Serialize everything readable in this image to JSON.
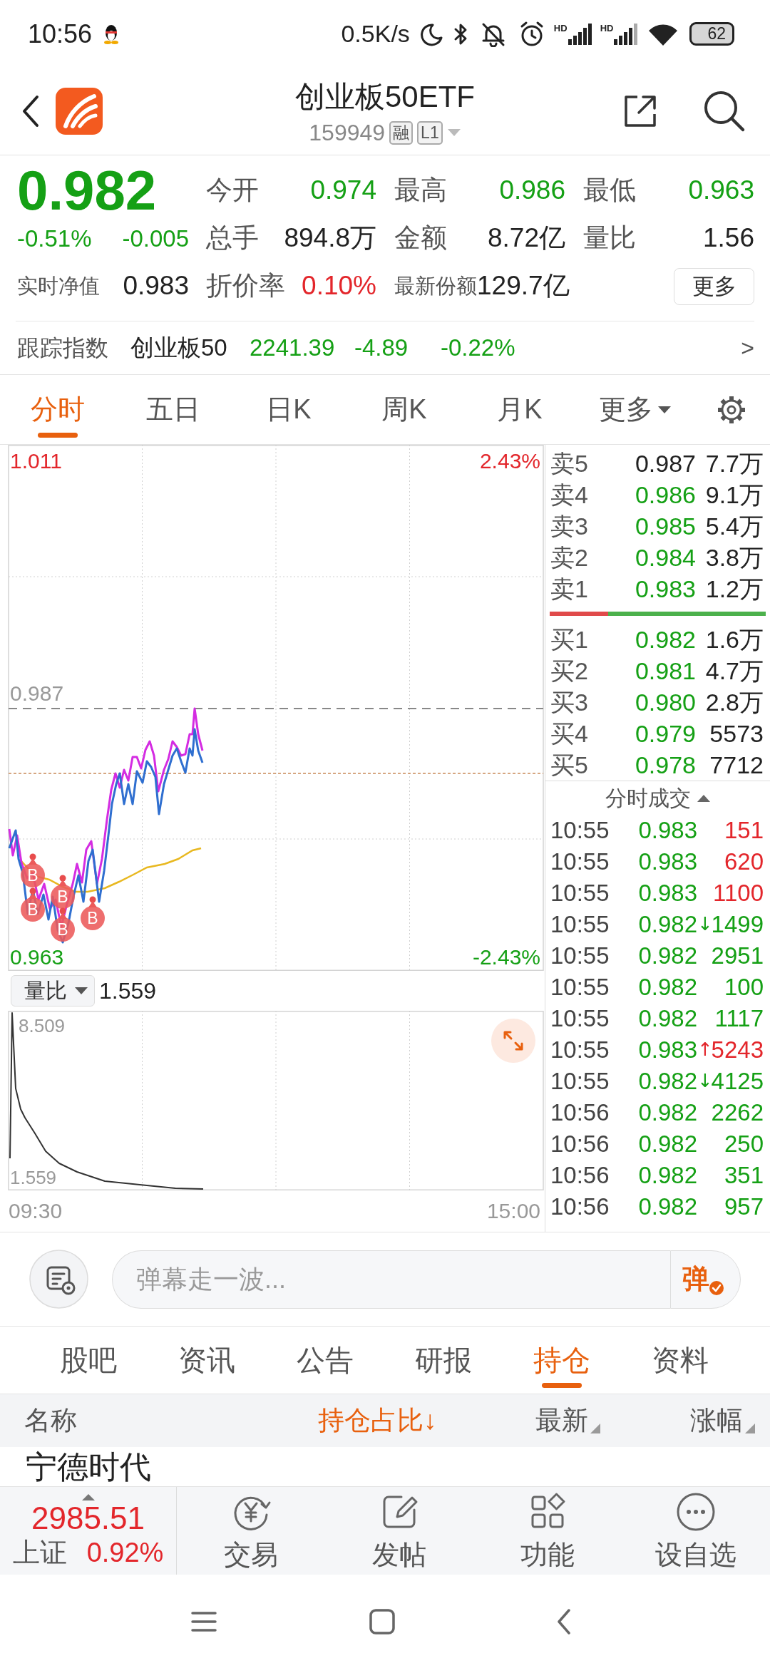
{
  "status_bar": {
    "time": "10:56",
    "network_speed": "0.5K/s",
    "signals": [
      {
        "label": "HD"
      },
      {
        "label": "HD"
      }
    ],
    "battery": "62"
  },
  "header": {
    "title": "创业板50ETF",
    "code": "159949",
    "tags": [
      "融",
      "L1"
    ]
  },
  "quote": {
    "price": "0.982",
    "color": "#15a015",
    "change_pct": "-0.51%",
    "change": "-0.005",
    "stats": [
      {
        "label": "今开",
        "value": "0.974",
        "color": "#15a015"
      },
      {
        "label": "最高",
        "value": "0.986",
        "color": "#15a015"
      },
      {
        "label": "最低",
        "value": "0.963",
        "color": "#15a015"
      },
      {
        "label": "总手",
        "value": "894.8万",
        "color": "#222222"
      },
      {
        "label": "金额",
        "value": "8.72亿",
        "color": "#222222"
      },
      {
        "label": "量比",
        "value": "1.56",
        "color": "#222222"
      }
    ],
    "extras": [
      {
        "label": "实时净值",
        "value": "0.983",
        "color": "#222222"
      },
      {
        "label": "折价率",
        "value": "0.10%",
        "color": "#e3262b"
      },
      {
        "label": "最新份额",
        "value": "129.7亿",
        "color": "#222222"
      }
    ],
    "more_button": "更多"
  },
  "tracking": {
    "label": "跟踪指数",
    "index": "创业板50",
    "value": "2241.39",
    "change": "-4.89",
    "change_pct": "-0.22%",
    "color": "#15a015",
    "arrow": ">"
  },
  "chart_tabs": [
    {
      "label": "分时",
      "selected": true
    },
    {
      "label": "五日",
      "selected": false
    },
    {
      "label": "日K",
      "selected": false
    },
    {
      "label": "周K",
      "selected": false
    },
    {
      "label": "月K",
      "selected": false
    },
    {
      "label": "更多",
      "selected": false,
      "kind": "menu"
    }
  ],
  "intraday_chart": {
    "high_price": "1.011",
    "high_pct": "2.43%",
    "ref_price": "0.987",
    "low_price": "0.963",
    "low_pct": "-2.43%",
    "markers": [
      {
        "label": "B"
      },
      {
        "label": "B"
      },
      {
        "label": "B"
      },
      {
        "label": "B"
      },
      {
        "label": "B"
      }
    ],
    "indicator": {
      "name": "量比",
      "value": "1.559",
      "max": "8.509",
      "min": "1.559"
    },
    "time_start": "09:30",
    "time_end": "15:00"
  },
  "order_book": {
    "asks": [
      {
        "label": "卖5",
        "price": "0.987",
        "volume": "7.7万",
        "color": "#222222"
      },
      {
        "label": "卖4",
        "price": "0.986",
        "volume": "9.1万",
        "color": "#15a015"
      },
      {
        "label": "卖3",
        "price": "0.985",
        "volume": "5.4万",
        "color": "#15a015"
      },
      {
        "label": "卖2",
        "price": "0.984",
        "volume": "3.8万",
        "color": "#15a015"
      },
      {
        "label": "卖1",
        "price": "0.983",
        "volume": "1.2万",
        "color": "#15a015"
      }
    ],
    "ratio_bar": {
      "level": 0.27
    },
    "bids": [
      {
        "label": "买1",
        "price": "0.982",
        "volume": "1.6万",
        "color": "#15a015"
      },
      {
        "label": "买2",
        "price": "0.981",
        "volume": "4.7万",
        "color": "#15a015"
      },
      {
        "label": "买3",
        "price": "0.980",
        "volume": "2.8万",
        "color": "#15a015"
      },
      {
        "label": "买4",
        "price": "0.979",
        "volume": "5573",
        "color": "#15a015"
      },
      {
        "label": "买5",
        "price": "0.978",
        "volume": "7712",
        "color": "#15a015"
      }
    ],
    "trades_title": "分时成交",
    "trades": [
      {
        "time": "10:55",
        "price": {
          "text": "0.983",
          "color": "#15a015"
        },
        "volume": {
          "text": "151",
          "color": "#e3262b"
        }
      },
      {
        "time": "10:55",
        "price": {
          "text": "0.983",
          "color": "#15a015"
        },
        "volume": {
          "text": "620",
          "color": "#e3262b"
        }
      },
      {
        "time": "10:55",
        "price": {
          "text": "0.983",
          "color": "#15a015"
        },
        "volume": {
          "text": "1100",
          "color": "#e3262b"
        }
      },
      {
        "time": "10:55",
        "price": {
          "text": "0.982",
          "color": "#15a015"
        },
        "flag": "↓",
        "volume": {
          "text": "1499",
          "color": "#15a015"
        }
      },
      {
        "time": "10:55",
        "price": {
          "text": "0.982",
          "color": "#15a015"
        },
        "volume": {
          "text": "2951",
          "color": "#15a015"
        }
      },
      {
        "time": "10:55",
        "price": {
          "text": "0.982",
          "color": "#15a015"
        },
        "volume": {
          "text": "100",
          "color": "#15a015"
        }
      },
      {
        "time": "10:55",
        "price": {
          "text": "0.982",
          "color": "#15a015"
        },
        "volume": {
          "text": "1117",
          "color": "#15a015"
        }
      },
      {
        "time": "10:55",
        "price": {
          "text": "0.983",
          "color": "#15a015"
        },
        "flag": "↑",
        "volume": {
          "text": "5243",
          "color": "#e3262b"
        }
      },
      {
        "time": "10:55",
        "price": {
          "text": "0.982",
          "color": "#15a015"
        },
        "flag": "↓",
        "volume": {
          "text": "4125",
          "color": "#15a015"
        }
      },
      {
        "time": "10:56",
        "price": {
          "text": "0.982",
          "color": "#15a015"
        },
        "volume": {
          "text": "2262",
          "color": "#15a015"
        }
      },
      {
        "time": "10:56",
        "price": {
          "text": "0.982",
          "color": "#15a015"
        },
        "volume": {
          "text": "250",
          "color": "#15a015"
        }
      },
      {
        "time": "10:56",
        "price": {
          "text": "0.982",
          "color": "#15a015"
        },
        "volume": {
          "text": "351",
          "color": "#15a015"
        }
      },
      {
        "time": "10:56",
        "price": {
          "text": "0.982",
          "color": "#15a015"
        },
        "volume": {
          "text": "957",
          "color": "#15a015"
        }
      }
    ]
  },
  "comment_bar": {
    "placeholder": "弹幕走一波...",
    "send_label": "弹"
  },
  "info_tabs": [
    {
      "label": "股吧",
      "selected": false
    },
    {
      "label": "资讯",
      "selected": false
    },
    {
      "label": "公告",
      "selected": false
    },
    {
      "label": "研报",
      "selected": false
    },
    {
      "label": "持仓",
      "selected": true
    },
    {
      "label": "资料",
      "selected": false
    }
  ],
  "holdings": {
    "columns": [
      {
        "label": "名称",
        "kind": "plain"
      },
      {
        "label": "持仓占比↓",
        "kind": "sorted"
      },
      {
        "label": "最新",
        "kind": "sortable"
      },
      {
        "label": "涨幅",
        "kind": "sortable"
      }
    ],
    "rows": [
      {
        "name": "宁德时代"
      }
    ]
  },
  "bottom_bar": {
    "index": {
      "value": "2985.51",
      "name": "上证",
      "change_pct": "0.92%",
      "color": "#e3262b"
    },
    "actions": [
      {
        "label": "交易",
        "kind": "trade"
      },
      {
        "label": "发帖",
        "kind": "post"
      },
      {
        "label": "功能",
        "kind": "functions"
      },
      {
        "label": "设自选",
        "kind": "watchlist"
      }
    ]
  }
}
